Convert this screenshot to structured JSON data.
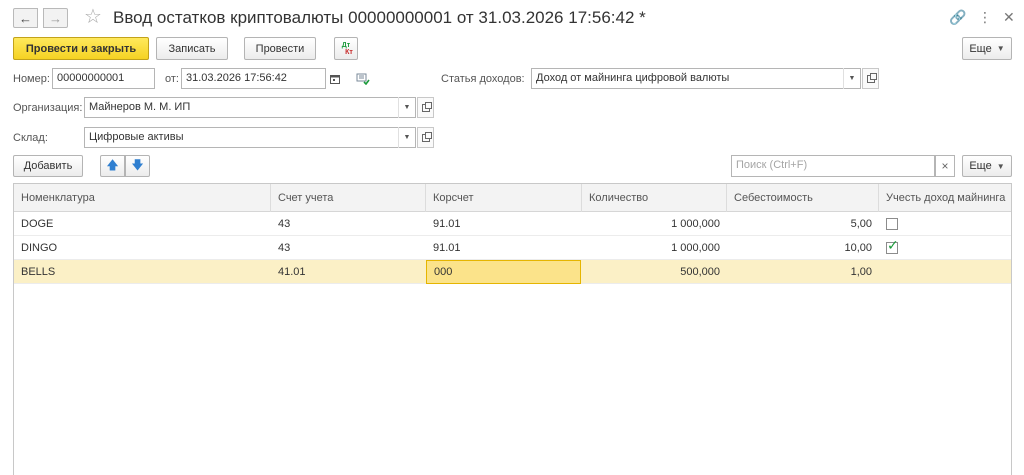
{
  "window": {
    "title": "Ввод остатков криптовалюты 00000000001 от 31.03.2026 17:56:42 *",
    "back_glyph": "←",
    "forward_glyph": "→",
    "star_glyph": "☆",
    "link_glyph": "🔗",
    "menu_glyph": "⋮",
    "minimize_glyph": "▭",
    "close_glyph": "✕"
  },
  "toolbar": {
    "post_and_close": "Провести и закрыть",
    "save": "Записать",
    "post": "Провести",
    "dt_kt_top": "Дт",
    "dt_kt_bottom": "Кт",
    "more": "Еще"
  },
  "form": {
    "number_label": "Номер:",
    "number_value": "00000000001",
    "date_label": "от:",
    "date_value": "31.03.2026 17:56:42",
    "income_label": "Статья доходов:",
    "income_value": "Доход от майнинга цифровой валюты",
    "org_label": "Организация:",
    "org_value": "Майнеров М. М. ИП",
    "warehouse_label": "Склад:",
    "warehouse_value": "Цифровые активы"
  },
  "table_toolbar": {
    "add": "Добавить",
    "up_glyph": "🡅",
    "down_glyph": "🡇",
    "search_placeholder": "Поиск (Ctrl+F)",
    "clear_glyph": "×",
    "more": "Еще"
  },
  "table": {
    "columns": [
      "Номенклатура",
      "Счет учета",
      "Корсчет",
      "Количество",
      "Себестоимость",
      "Учесть доход майнинга"
    ],
    "rows": [
      {
        "item": "DOGE",
        "account": "43",
        "corr": "91.01",
        "qty": "1 000,000",
        "cost": "5,00",
        "mining": false
      },
      {
        "item": "DINGO",
        "account": "43",
        "corr": "91.01",
        "qty": "1 000,000",
        "cost": "10,00",
        "mining": true
      },
      {
        "item": "BELLS",
        "account": "41.01",
        "corr": "000",
        "qty": "500,000",
        "cost": "1,00",
        "mining": null
      }
    ],
    "selected_row": 2,
    "active_cell": "corr"
  },
  "colors": {
    "primary_button": "#f5d223",
    "selected_row": "#fbf0c6",
    "active_cell": "#fbe38a",
    "check_mark": "#1a9a3a",
    "arrow_blue": "#2f7fd0"
  }
}
